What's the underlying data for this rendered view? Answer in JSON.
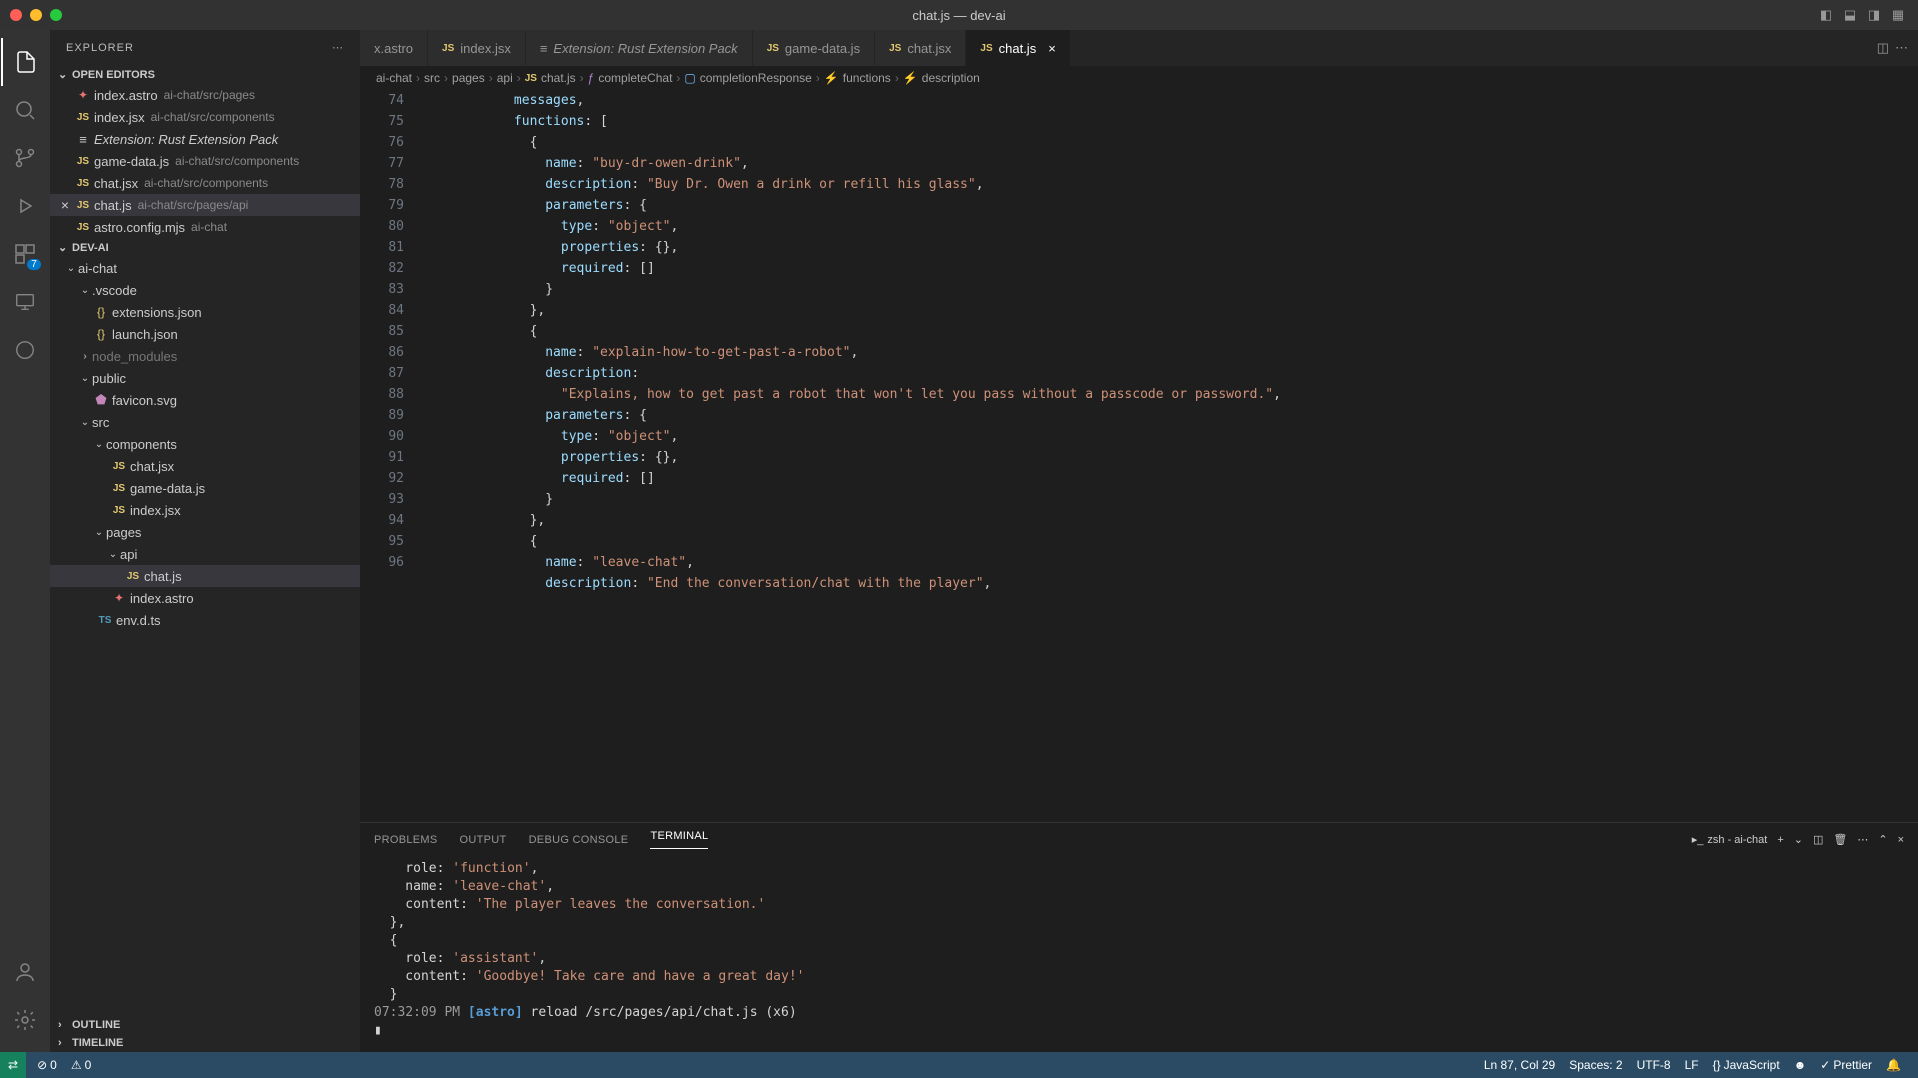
{
  "window": {
    "title": "chat.js — dev-ai"
  },
  "activity": {
    "badge": "7"
  },
  "sidebar": {
    "title": "EXPLORER",
    "openEditors": "OPEN EDITORS",
    "project": "DEV-AI",
    "outline": "OUTLINE",
    "timeline": "TIMELINE",
    "editors": [
      {
        "name": "index.astro",
        "path": "ai-chat/src/pages"
      },
      {
        "name": "index.jsx",
        "path": "ai-chat/src/components"
      },
      {
        "name": "Extension: Rust Extension Pack",
        "path": ""
      },
      {
        "name": "game-data.js",
        "path": "ai-chat/src/components"
      },
      {
        "name": "chat.jsx",
        "path": "ai-chat/src/components"
      },
      {
        "name": "chat.js",
        "path": "ai-chat/src/pages/api"
      },
      {
        "name": "astro.config.mjs",
        "path": "ai-chat"
      }
    ],
    "tree": {
      "aichat": "ai-chat",
      "vscode": ".vscode",
      "extensions": "extensions.json",
      "launch": "launch.json",
      "node_modules": "node_modules",
      "public": "public",
      "favicon": "favicon.svg",
      "src": "src",
      "components": "components",
      "chatjsx": "chat.jsx",
      "gamedata": "game-data.js",
      "indexjsx": "index.jsx",
      "pages": "pages",
      "api": "api",
      "chatjs": "chat.js",
      "indexastro": "index.astro",
      "envdts": "env.d.ts"
    }
  },
  "tabs": [
    {
      "name": "x.astro"
    },
    {
      "name": "index.jsx"
    },
    {
      "name": "Extension: Rust Extension Pack"
    },
    {
      "name": "game-data.js"
    },
    {
      "name": "chat.jsx"
    },
    {
      "name": "chat.js"
    }
  ],
  "breadcrumb": {
    "parts": [
      "ai-chat",
      "src",
      "pages",
      "api",
      "chat.js",
      "completeChat",
      "completionResponse",
      "functions",
      "description"
    ]
  },
  "code": {
    "lines": [
      {
        "n": "",
        "t": "            messages,"
      },
      {
        "n": "74",
        "t": "            functions: ["
      },
      {
        "n": "75",
        "t": "              {"
      },
      {
        "n": "76",
        "t": "                name: \"buy-dr-owen-drink\","
      },
      {
        "n": "77",
        "t": "                description: \"Buy Dr. Owen a drink or refill his glass\","
      },
      {
        "n": "78",
        "t": "                parameters: {"
      },
      {
        "n": "79",
        "t": "                  type: \"object\","
      },
      {
        "n": "80",
        "t": "                  properties: {},"
      },
      {
        "n": "81",
        "t": "                  required: []"
      },
      {
        "n": "82",
        "t": "                }"
      },
      {
        "n": "83",
        "t": "              },"
      },
      {
        "n": "84",
        "t": "              {"
      },
      {
        "n": "85",
        "t": "                name: \"explain-how-to-get-past-a-robot\","
      },
      {
        "n": "86",
        "t": "                description:"
      },
      {
        "n": "87",
        "t": "                  \"Explains, how to get past a robot that won't let you pass without a passcode or password.\","
      },
      {
        "n": "88",
        "t": "                parameters: {"
      },
      {
        "n": "89",
        "t": "                  type: \"object\","
      },
      {
        "n": "90",
        "t": "                  properties: {},"
      },
      {
        "n": "91",
        "t": "                  required: []"
      },
      {
        "n": "92",
        "t": "                }"
      },
      {
        "n": "93",
        "t": "              },"
      },
      {
        "n": "94",
        "t": "              {"
      },
      {
        "n": "95",
        "t": "                name: \"leave-chat\","
      },
      {
        "n": "96",
        "t": "                description: \"End the conversation/chat with the player\","
      }
    ]
  },
  "panel": {
    "tabs": {
      "problems": "PROBLEMS",
      "output": "OUTPUT",
      "debug": "DEBUG CONSOLE",
      "terminal": "TERMINAL"
    },
    "shell": "zsh - ai-chat",
    "content": [
      "    role: 'function',",
      "    name: 'leave-chat',",
      "    content: 'The player leaves the conversation.'",
      "  },",
      "  {",
      "    role: 'assistant',",
      "    content: 'Goodbye! Take care and have a great day!'",
      "  }"
    ],
    "reload": {
      "ts": "07:32:09 PM",
      "tag": "[astro]",
      "msg": "reload /src/pages/api/chat.js (x6)"
    }
  },
  "status": {
    "errors": "0",
    "warnings": "0",
    "cursor": "Ln 87, Col 29",
    "spaces": "Spaces: 2",
    "encoding": "UTF-8",
    "eol": "LF",
    "lang": "JavaScript",
    "prettier": "Prettier"
  }
}
